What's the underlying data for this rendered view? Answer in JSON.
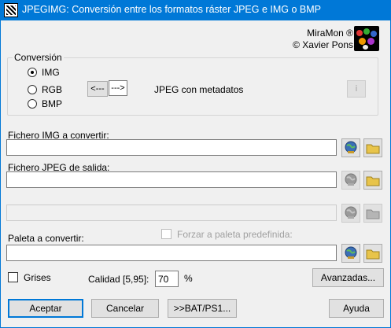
{
  "window": {
    "title": "JPEGIMG: Conversión entre los formatos ráster JPEG e IMG o BMP"
  },
  "brand": {
    "line1": "MiraMon ®",
    "line2": "© Xavier Pons"
  },
  "conversion": {
    "group_label": "Conversión",
    "options": [
      "IMG",
      "RGB",
      "BMP"
    ],
    "selected": "IMG",
    "left_arrow": "<---",
    "right_arrow": "--->",
    "direction_text": "JPEG con metadatos",
    "info_label": "i"
  },
  "input_file": {
    "label": "Fichero IMG a convertir:",
    "value": ""
  },
  "output_file": {
    "label": "Fichero JPEG de salida:",
    "value": ""
  },
  "extra_file": {
    "value": ""
  },
  "palette": {
    "label": "Paleta a convertir:",
    "value": "",
    "force_label": "Forzar a paleta predefinida:"
  },
  "options": {
    "grayscale_label": "Grises",
    "quality_label": "Calidad [5,95]:",
    "quality_value": "70",
    "quality_unit": "%",
    "advanced_label": "Avanzadas..."
  },
  "actions": {
    "accept": "Aceptar",
    "cancel": "Cancelar",
    "bat": ">>BAT/PS1...",
    "help": "Ayuda"
  },
  "colors": {
    "titlebar": "#0078d7",
    "accent": "#0078d7",
    "folder": "#e8c44a"
  }
}
